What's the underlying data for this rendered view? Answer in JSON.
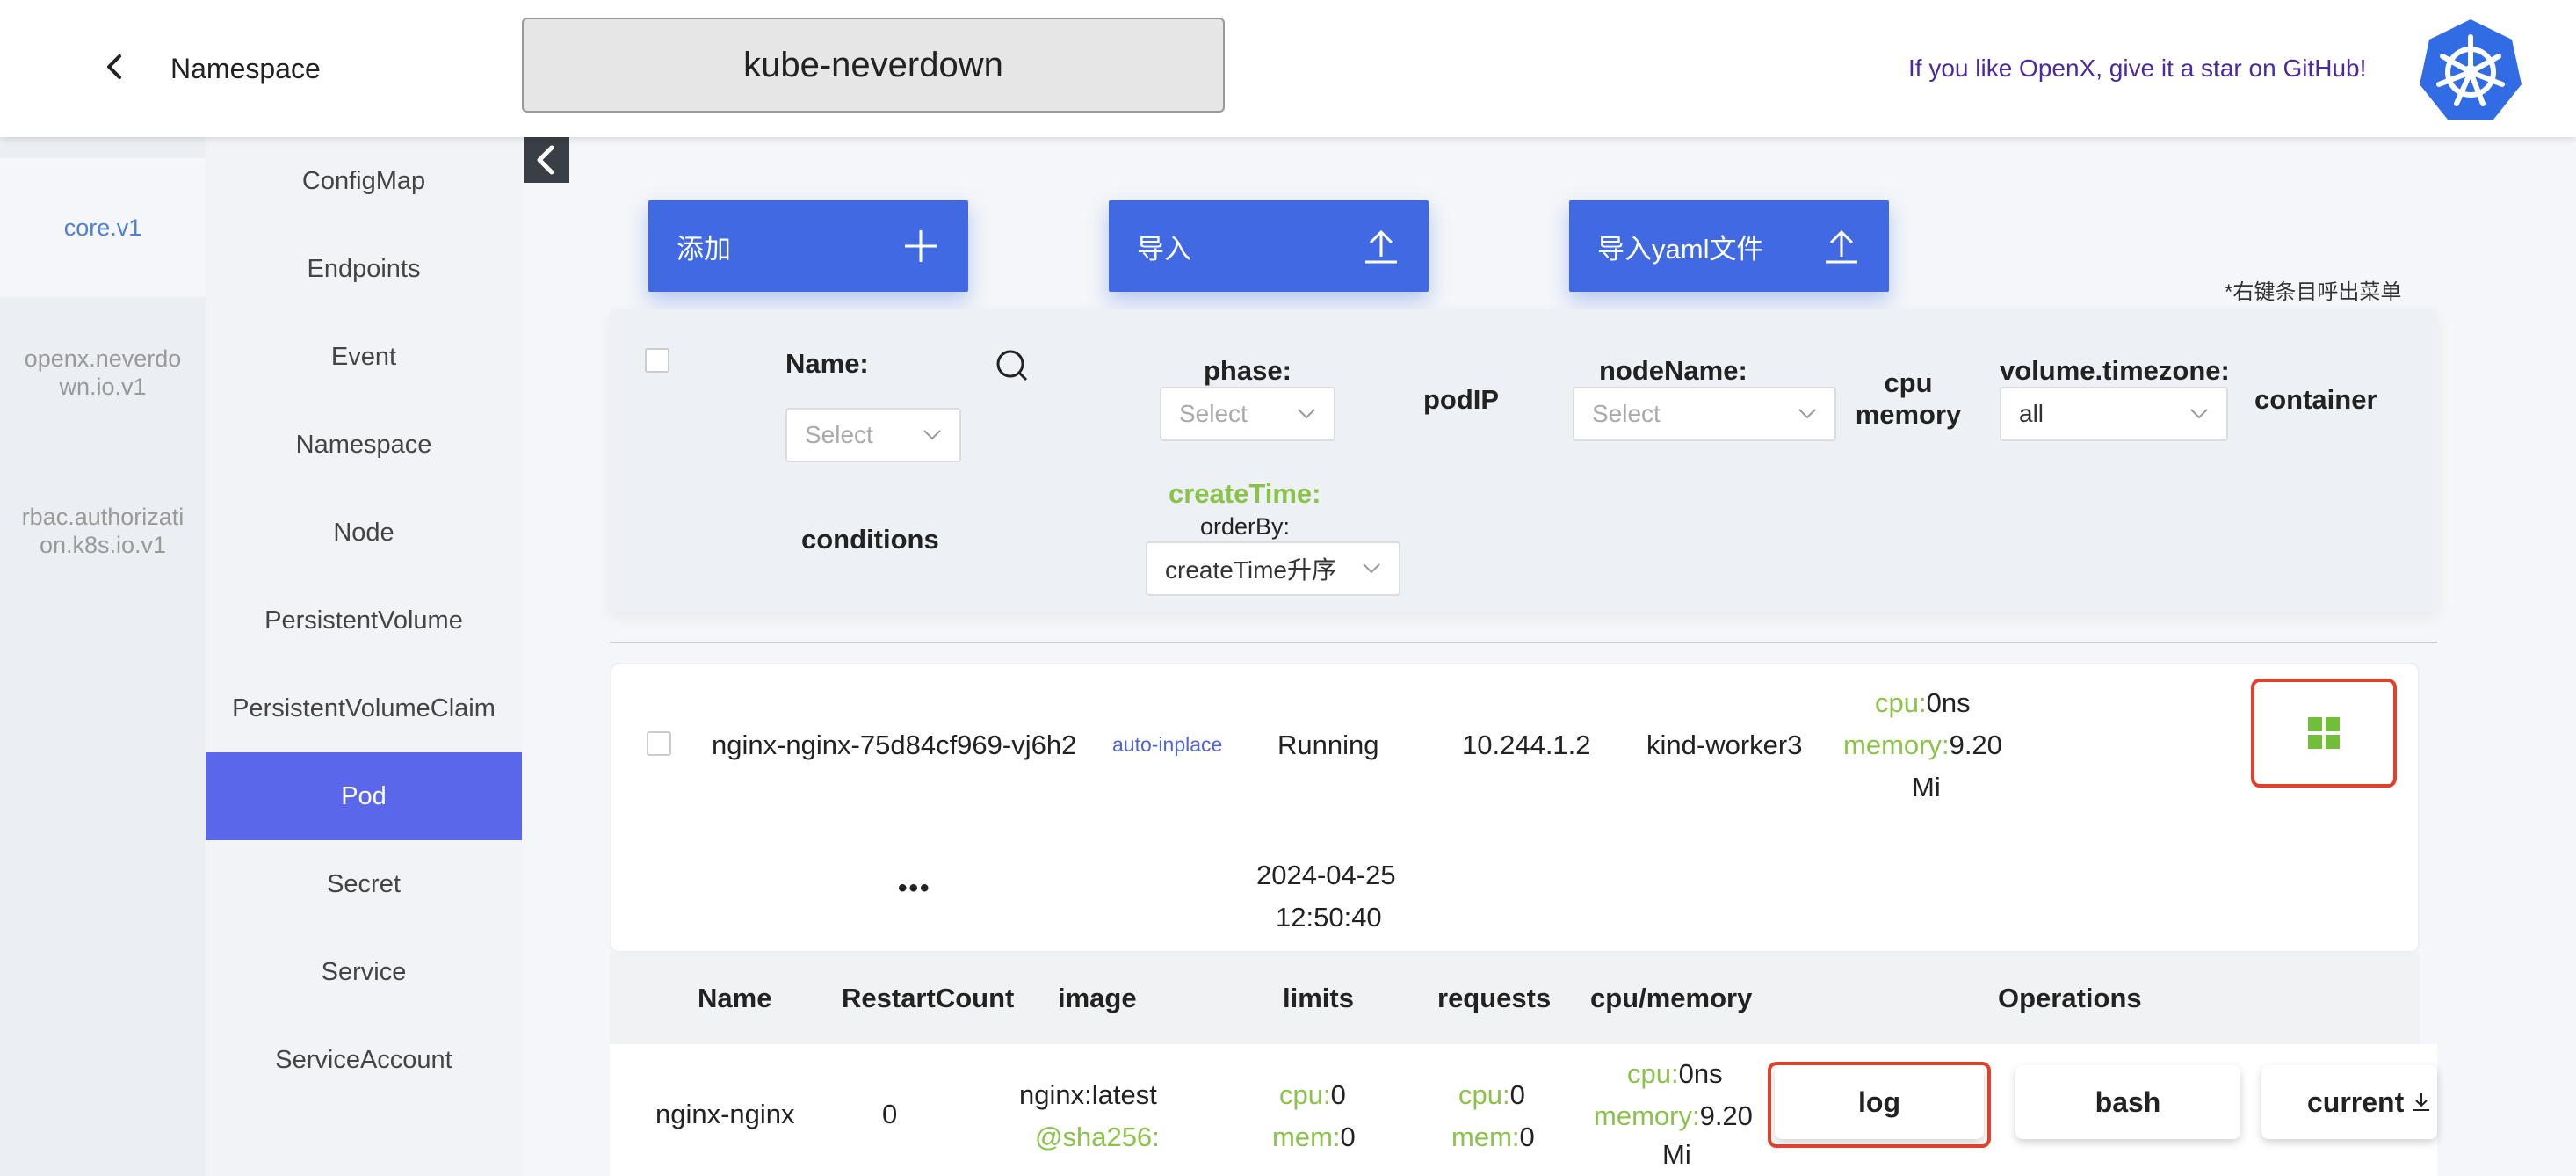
{
  "header": {
    "back_label": "back",
    "namespace_label": "Namespace",
    "namespace_value": "kube-neverdown",
    "github_text": "If you like OpenX, give it a star on GitHub!"
  },
  "groups": [
    {
      "label": "core.v1"
    },
    {
      "label": "openx.neverdo\nwn.io.v1"
    },
    {
      "label": "rbac.authorizati\non.k8s.io.v1"
    }
  ],
  "resources": [
    "ConfigMap",
    "Endpoints",
    "Event",
    "Namespace",
    "Node",
    "PersistentVolume",
    "PersistentVolumeClaim",
    "Pod",
    "Secret",
    "Service",
    "ServiceAccount"
  ],
  "active_resource": "Pod",
  "actions": {
    "add": "添加",
    "import": "导入",
    "import_yaml": "导入yaml文件",
    "hint": "*右键条目呼出菜单"
  },
  "filters": {
    "name_label": "Name:",
    "name_placeholder": "Select",
    "phase_label": "phase:",
    "phase_placeholder": "Select",
    "podip_label": "podIP",
    "nodename_label": "nodeName:",
    "nodename_placeholder": "Select",
    "cpu_label": "cpu",
    "memory_label": "memory",
    "timezone_label": "volume.timezone:",
    "timezone_value": "all",
    "container_label": "container",
    "conditions_label": "conditions",
    "createtime_label": "createTime:",
    "orderby_label": "orderBy:",
    "orderby_value": "createTime升序"
  },
  "pod": {
    "name": "nginx-nginx-75d84cf969-vj6h2",
    "tag": "auto-inplace",
    "phase": "Running",
    "ip": "10.244.1.2",
    "node": "kind-worker3",
    "cpu_key": "cpu:",
    "cpu_val": "0ns",
    "mem_key": "memory:",
    "mem_val": "9.20",
    "mem_unit": "Mi",
    "more": "•••",
    "create_date": "2024-04-25",
    "create_time": "12:50:40"
  },
  "container_table": {
    "headers": [
      "Name",
      "RestartCount",
      "image",
      "limits",
      "requests",
      "cpu/memory",
      "Operations"
    ],
    "row": {
      "name": "nginx-nginx",
      "restart": "0",
      "image_line1": "nginx:latest",
      "image_line2": "@sha256:",
      "limits_cpu_key": "cpu:",
      "limits_cpu_val": "0",
      "limits_mem_key": "mem:",
      "limits_mem_val": "0",
      "req_cpu_key": "cpu:",
      "req_cpu_val": "0",
      "req_mem_key": "mem:",
      "req_mem_val": "0",
      "usage_cpu_key": "cpu:",
      "usage_cpu_val": "0ns",
      "usage_mem_key": "memory:",
      "usage_mem_val": "9.20",
      "usage_mem_unit": "Mi"
    },
    "ops": {
      "log": "log",
      "bash": "bash",
      "current": "current"
    }
  },
  "colors": {
    "accent": "#4169e1",
    "active_sidebar": "#5a67e8",
    "highlight_outline": "#e0412c",
    "green_label": "#8bc34a",
    "k8s_blue": "#326ce5"
  }
}
